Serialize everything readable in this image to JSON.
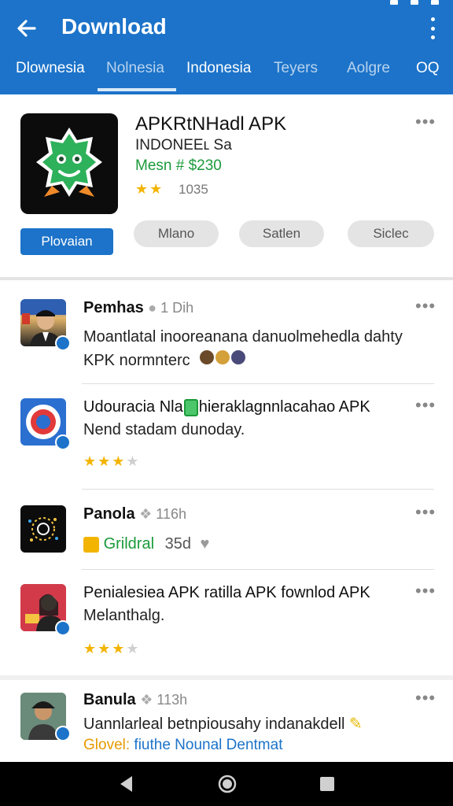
{
  "app_bar": {
    "title": "Download",
    "back_icon": "arrow-left-icon",
    "menu_icon": "more-vertical-icon",
    "color": "#1c73c9"
  },
  "tabs": [
    {
      "label": "Dlownesia",
      "active": true
    },
    {
      "label": "Nolnesia",
      "active": false
    },
    {
      "label": "Indonesia",
      "active": true
    },
    {
      "label": "Teyers",
      "active": false
    },
    {
      "label": "Aolgre",
      "active": false
    },
    {
      "label": "OQ",
      "active": true
    }
  ],
  "app": {
    "name": "APKRtNHadl APK",
    "developer": "INDONEEʟ Sa",
    "version": "Mesn # $230",
    "stars": "★★",
    "rating": "1035",
    "primary_button": "Plovaian",
    "buttons": [
      "Mlano",
      "Satlen",
      "Siclec"
    ],
    "more": "•••"
  },
  "comments": [
    {
      "author": "Pemhas",
      "time": "1 Dih",
      "text_line1": "Moantlatal inooreanana danuolmehedla dahty",
      "text_line2": "KPK normnterc",
      "more": "•••"
    },
    {
      "author": "Udouracia Nla",
      "title_rest": "hieraklagnnlacahao APK",
      "text_line1": "Nend stadam dunoday.",
      "stars": "★★★",
      "star_empty": "★",
      "more": "•••"
    },
    {
      "author": "Panola",
      "time": "116h",
      "badge_label": "Grildral",
      "badge_value": "35d",
      "more": "•••"
    },
    {
      "author": "Penialesiea",
      "title_rest": "APK ratilla APK fownlod APK",
      "text_line1": "Melanthalg.",
      "stars": "★★★",
      "star_empty": "★",
      "more": "•••"
    },
    {
      "author": "Banula",
      "time": "113h",
      "text_line1": "Uannlarleal betnpiousahy indanakdell",
      "link_label": "Glovel:",
      "link_text": "fiuthe Nounal Dentmat",
      "more": "•••"
    }
  ],
  "nav_bar": {
    "back_icon": "triangle-back-icon",
    "home_icon": "circle-home-icon",
    "recents_icon": "square-recents-icon"
  }
}
